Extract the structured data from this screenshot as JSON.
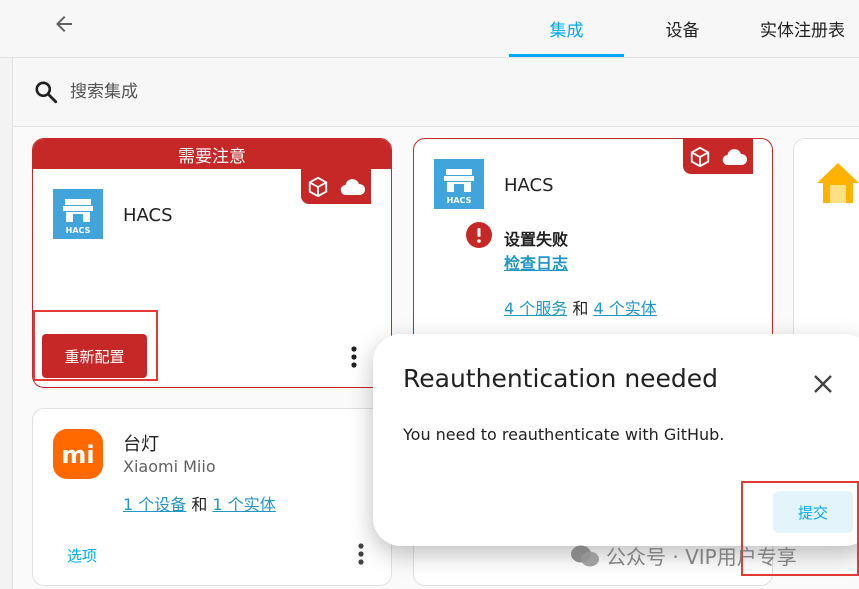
{
  "tabs": [
    {
      "label": "集成",
      "active": true
    },
    {
      "label": "设备",
      "active": false
    },
    {
      "label": "实体注册表",
      "active": false
    }
  ],
  "search": {
    "placeholder": "搜索集成"
  },
  "attention_card": {
    "header": "需要注意",
    "title": "HACS",
    "logo_text": "HACS",
    "button_label": "重新配置"
  },
  "failed_card": {
    "title": "HACS",
    "logo_text": "HACS",
    "error_title": "设置失败",
    "error_link": "检查日志",
    "services_link": "4 个服务",
    "connector": "和",
    "entities_link": "4 个实体"
  },
  "lamp_card": {
    "title": "台灯",
    "subtitle": "Xiaomi Miio",
    "logo_text": "mi",
    "devices_link": "1 个设备",
    "connector": "和",
    "entities_link": "1 个实体",
    "options_label": "选项"
  },
  "dialog": {
    "title": "Reauthentication needed",
    "body": "You need to reauthenticate with GitHub.",
    "submit_label": "提交"
  },
  "watermark": "公众号 · VIP用户专享",
  "colors": {
    "accent": "#03a9f4",
    "error": "#c62828",
    "hacs_blue": "#41a5dc",
    "xiaomi_orange": "#ff6900"
  }
}
